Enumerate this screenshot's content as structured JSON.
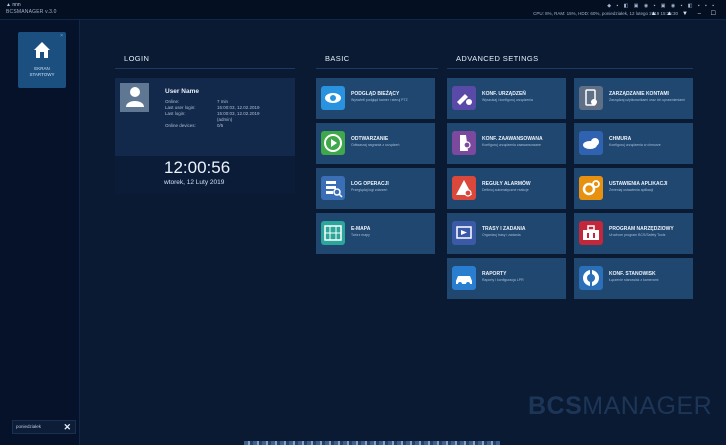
{
  "topbar": {
    "brand": "▲ nnn",
    "app_title": "BCSMANAGER v.3.0",
    "status": "CPU: 8%, RAM: 15%, HDD: 60%, poniedziałek, 12 lutego 2019 15:25:30",
    "tray": "◆ ▪ ◧ ▣ ◉ ▪ ▣ ◉ ▪ ◧ ▪ ▪ ▪",
    "window_controls": "▲ ▲ ▼ – ☐"
  },
  "sidebar": {
    "home_label_line1": "EKRAN",
    "home_label_line2": "STARTOWY",
    "home_close": "×",
    "user": "poniedziałek",
    "close": "✕"
  },
  "sections": {
    "login": "LOGIN",
    "basic": "BASIC",
    "advanced": "ADVANCED SETINGS"
  },
  "login": {
    "user_name": "User Name",
    "rows": [
      {
        "k": "Online:",
        "v": "7 min"
      },
      {
        "k": "Last user login:",
        "v": "15:00:03, 12.02.2019"
      },
      {
        "k": "Last login:",
        "v": "15:00:03, 12.02.2019"
      },
      {
        "k": "",
        "v": "(admin)"
      },
      {
        "k": "Online devices:",
        "v": "0/5"
      }
    ],
    "time": "12:00:56",
    "date": "wtorek, 12 Luty 2019"
  },
  "basic_tiles": [
    {
      "title": "PODGLĄD BIEŻĄCY",
      "sub": "Wyświetl podgląd kamer i steruj PTZ",
      "icon": "eye-icon",
      "color": "#2a93e0"
    },
    {
      "title": "ODTWARZANIE",
      "sub": "Odtwarzaj nagrania z urządzeń",
      "icon": "play-icon",
      "color": "#3fa84a"
    },
    {
      "title": "LOG OPERACJI",
      "sub": "Przeglądaj logi zdarzeń",
      "icon": "log-search-icon",
      "color": "#3a6fb8"
    },
    {
      "title": "E-MAPA",
      "sub": "Twórz mapy",
      "icon": "map-icon",
      "color": "#2aa79a"
    }
  ],
  "advanced_tiles": [
    {
      "title": "KONF. URZĄDZEŃ",
      "sub": "Wyszukaj i konfiguruj urządzenia",
      "icon": "device-config-icon",
      "color": "#5a4aa8"
    },
    {
      "title": "ZARZĄDZANIE KONTAMI",
      "sub": "Zarządzaj użytkownikami oraz ich uprawnieniami",
      "icon": "user-management-icon",
      "color": "#5f6f86"
    },
    {
      "title": "KONF. ZAAWANSOWANA",
      "sub": "Konfiguruj urządzenia zaawansowane",
      "icon": "advanced-config-icon",
      "color": "#7b4a9e"
    },
    {
      "title": "CHMURA",
      "sub": "Konfiguruj urządzenia w chmurze",
      "icon": "cloud-icon",
      "color": "#2f62b0"
    },
    {
      "title": "REGUŁY ALARMÓW",
      "sub": "Definiuj automatyczne reakcje",
      "icon": "alarm-rules-icon",
      "color": "#d9483b"
    },
    {
      "title": "USTAWIENIA APLIKACJI",
      "sub": "Zmieniaj ustawienia aplikacji",
      "icon": "app-settings-icon",
      "color": "#e8910f"
    },
    {
      "title": "TRASY I ZADANIA",
      "sub": "Organizuj trasy i zadania",
      "icon": "routes-icon",
      "color": "#3a5aa8"
    },
    {
      "title": "PROGRAM NARZĘDZIOWY",
      "sub": "Uruchom program BCS/Safety Tools",
      "icon": "toolbox-icon",
      "color": "#c2283a"
    },
    {
      "title": "RAPORTY",
      "sub": "Raporty i konfiguracja LPR",
      "icon": "car-report-icon",
      "color": "#2a7ed0"
    },
    {
      "title": "KONF. STANOWISK",
      "sub": "Łączenie stanowisk z kamerami",
      "icon": "workstation-icon",
      "color": "#2a6fb8"
    }
  ],
  "watermark": {
    "a": "BCS",
    "b": "MANAGER"
  }
}
